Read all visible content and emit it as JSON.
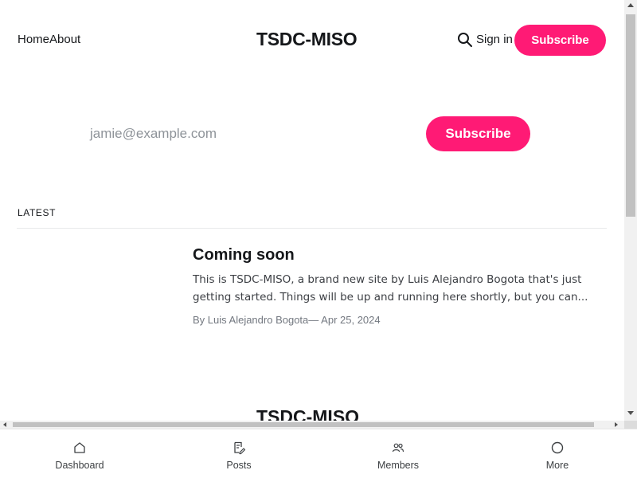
{
  "header": {
    "nav": [
      "Home",
      "About"
    ],
    "site_title": "TSDC-MISO",
    "signin_label": "Sign in",
    "subscribe_label": "Subscribe"
  },
  "signup": {
    "email_placeholder": "jamie@example.com",
    "subscribe_label": "Subscribe"
  },
  "latest": {
    "section_label": "LATEST",
    "posts": [
      {
        "title": "Coming soon",
        "excerpt_line1": "This is TSDC-MISO, a brand new site by Luis Alejandro Bogota that's just",
        "excerpt_line2": "getting started. Things will be up and running here shortly, but you can...",
        "author": "By Luis Alejandro Bogota",
        "date": "— Apr 25, 2024"
      }
    ]
  },
  "footer": {
    "site_title": "TSDC-MISO"
  },
  "tabbar": {
    "tabs": [
      {
        "label": "Dashboard",
        "icon": "home-icon"
      },
      {
        "label": "Posts",
        "icon": "edit-document-icon"
      },
      {
        "label": "Members",
        "icon": "people-icon"
      },
      {
        "label": "More",
        "icon": "circle-icon"
      }
    ]
  },
  "colors": {
    "accent": "#ff1a75",
    "text": "#15171a",
    "muted": "#737880"
  }
}
